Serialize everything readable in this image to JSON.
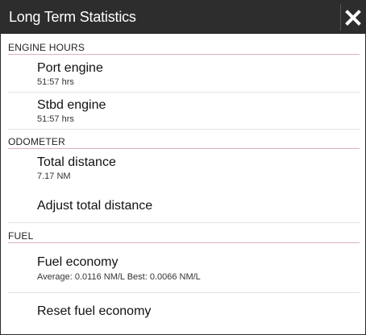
{
  "dialog": {
    "title": "Long Term Statistics",
    "close_icon": "close-icon"
  },
  "sections": {
    "engine_hours": {
      "header": "ENGINE HOURS",
      "port_engine": {
        "label": "Port engine",
        "value": "51:57 hrs"
      },
      "stbd_engine": {
        "label": "Stbd engine",
        "value": "51:57 hrs"
      }
    },
    "odometer": {
      "header": "ODOMETER",
      "total_distance": {
        "label": "Total distance",
        "value": "7.17 NM"
      },
      "adjust_total_distance": {
        "label": "Adjust total distance"
      }
    },
    "fuel": {
      "header": "FUEL",
      "fuel_economy": {
        "label": "Fuel economy",
        "value": "Average: 0.0116 NM/L Best: 0.0066 NM/L"
      },
      "reset_fuel_economy": {
        "label": "Reset fuel economy"
      }
    }
  },
  "colors": {
    "titlebar": "#2d2d2d",
    "section_line": "#d9b2c0",
    "item_line": "#e3e3e3"
  }
}
